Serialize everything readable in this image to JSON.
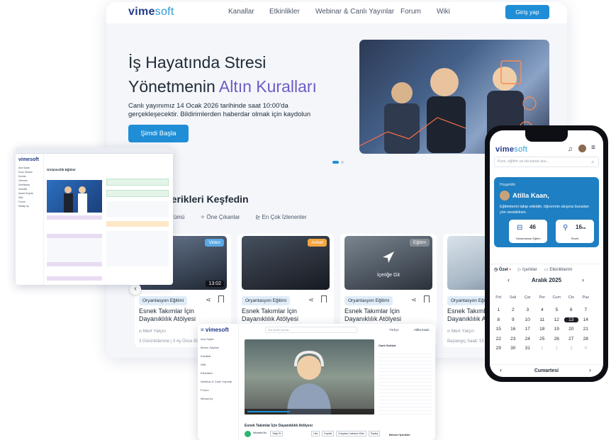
{
  "desktop": {
    "brand": {
      "main": "vime",
      "accent": "soft"
    },
    "nav": [
      "Kanallar",
      "Etkinlikler",
      "Webinar & Canlı Yayınlar",
      "Forum",
      "Wiki"
    ],
    "login_label": "Giriş yap",
    "hero": {
      "line1": "İş Hayatında Stresi",
      "line2_a": "Yönetmenin ",
      "line2_b": "Altın Kuralları",
      "subtitle": "Canlı yayınımız 14 Ocak 2026 tarihinde saat 10:00'da gerçekleşecektir. Bildirimlerden haberdar olmak için kaydolun",
      "cta": "Şimdi Başla"
    },
    "section_title": "İçerikleri Keşfedin",
    "tabs": [
      "Tümü",
      "Öne Çıkanlar",
      "En Çok İzlenenler"
    ],
    "cards": [
      {
        "badge": "Video",
        "badge_color": "#5aa9e6",
        "duration": "13:02",
        "category": "Oryantasyon Eğitimi",
        "title": "Esnek Takımlar İçin Dayanıklılık Atölyesi",
        "author": "Mert Yalçın",
        "meta": "3 Görüntülenme | 3 Ay Önce Eklendi"
      },
      {
        "badge": "Anket",
        "badge_color": "#f2a541",
        "duration": "",
        "category": "Oryantasyon Eğitimi",
        "title": "Esnek Takımlar İçin Dayanıklılık Atölyesi",
        "author": "",
        "meta": ""
      },
      {
        "badge": "Eğitim",
        "badge_color": "#8a94a3",
        "duration": "",
        "overlay": "İçeriğe Git",
        "category": "Oryantasyon Eğitimi",
        "title": "Esnek Takımlar İçin Dayanıklılık Atölyesi",
        "author": "",
        "meta": ""
      },
      {
        "badge": "",
        "badge_color": "#8a94a3",
        "duration": "",
        "category": "Oryantasyon Eğitimi",
        "title": "Esnek Takımlar İçin Dayanıklılık Atölyesi",
        "author": "Mert Yalçın",
        "meta": "Başlangıç Saati: 15 Kasım"
      }
    ]
  },
  "dashboard": {
    "brand": "vimesoft",
    "page_title": "Girişimcilik Eğitimi",
    "side_items": [
      "Ana Sayfa",
      "Konu Oluştur",
      "Kurslar",
      "Görevler",
      "Sertifikalar",
      "Kanallar",
      "Kanal Gruplar",
      "Wiki",
      "Forum",
      "Mesajı Aç"
    ]
  },
  "video": {
    "brand": "vimesoft",
    "search_placeholder": "Ara içerik arama...",
    "lang": "Türkçe",
    "user": "Atilla Kaan",
    "side_items": [
      "Ana Sayfa",
      "Benim Sayfam",
      "Kanallar",
      "Wiki",
      "Etkinlikler",
      "Webinar & Canlı Yayınlar",
      "Forum",
      "Mesajı Aç"
    ],
    "chat_title": "Canlı Sohbet",
    "title": "Esnek Takımlar İçin Dayanıklılık Atölyesi",
    "presenter": "Mustafa Bo",
    "actions": [
      "Takip Et",
      "Like",
      "Kaydet",
      "Dosyalar Listesine Ekle",
      "Paylaş"
    ],
    "similar": "Benzer İçerikler"
  },
  "phone": {
    "brand": {
      "main": "vime",
      "accent": "soft"
    },
    "search_placeholder": "Kurs, eğitim ya da kanal ara...",
    "greeting": "Hoşgeldin",
    "user": "Atilla Kaan,",
    "desc": "Eğitimlerini takip edebilir, öğrenmin akışına buradan yön verebilirsin.",
    "stats": [
      {
        "value": "46",
        "label": "Tamamlanan Eğitim"
      },
      {
        "value": "16",
        "unit": "SA",
        "label": "Rozet"
      }
    ],
    "tabs": [
      "Özet",
      "İçerikler",
      "Etkinliklerim"
    ],
    "month": "Aralık 2025",
    "weekdays": [
      "Pzt",
      "Salı",
      "Çar",
      "Per",
      "Cum",
      "Cts",
      "Paz"
    ],
    "weeks": [
      [
        "1",
        "2",
        "3",
        "4",
        "5",
        "6",
        "7"
      ],
      [
        "8",
        "9",
        "10",
        "11",
        "12",
        "13",
        "14"
      ],
      [
        "15",
        "16",
        "17",
        "18",
        "19",
        "20",
        "21"
      ],
      [
        "22",
        "23",
        "24",
        "25",
        "26",
        "27",
        "28"
      ],
      [
        "29",
        "30",
        "31",
        "1",
        "2",
        "3",
        "4"
      ]
    ],
    "today": "13",
    "day_label": "Cumartesi"
  }
}
